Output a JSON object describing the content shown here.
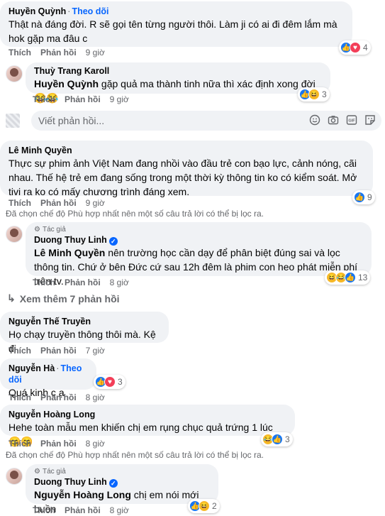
{
  "follow_label": "Theo dõi",
  "like_label": "Thích",
  "reply_label": "Phản hồi",
  "author_badge": "Tác giả",
  "filter_note": "Đã chọn chế độ Phù hợp nhất nên một số câu trả lời có thể bị lọc ra.",
  "reply_placeholder": "Viết phản hồi...",
  "see_more": "Xem thêm 7 phản hồi",
  "comments": [
    {
      "author": "Huyền Quỳnh",
      "text": "Thật nà đáng đời. R sẽ gọi tên từng người thôi. Làm ji có ai đi đêm lắm mà hok gặp ma đâu c",
      "time": "9 giờ",
      "reactions": "4"
    },
    {
      "author": "Thuỳ Trang Karoll",
      "mention": "Huyền Quỳnh",
      "text": " gặp quả ma thành tinh nữa thì xác định xong đời",
      "emoji": "😂😂",
      "time": "9 giờ",
      "reactions": "3"
    },
    {
      "author": "Lê Minh Quyền",
      "text": "Thực sự phim ảnh Việt Nam đang nhồi vào đầu trẻ con bạo lực, cảnh nóng, cãi nhau. Thế hệ trẻ em đang sống trong một thời kỳ thông tin ko có kiểm soát. Mở tivi ra ko có mấy chương trình đáng xem.",
      "time": "9 giờ",
      "reactions": "9"
    },
    {
      "author": "Duong Thuy Linh",
      "mention": "Lê Minh Quyền",
      "text": " nên trường học cần dạy để phân biệt đúng sai và lọc thông tin. Chứ ở bên Đức cứ sau 12h đêm là phim con heo phát miễn phí trên tv.",
      "time": "8 giờ",
      "reactions": "13"
    },
    {
      "author": "Nguyễn Thế Truyền",
      "text": "Họ chạy truyền thông thôi mà. Kệ đi",
      "time": "7 giờ"
    },
    {
      "author": "Nguyễn Hà",
      "text": "Quá kinh c ạ",
      "time": "8 giờ",
      "reactions": "3"
    },
    {
      "author": "Nguyễn Hoàng Long",
      "text": "Hehe toàn mẫu men khiến chị em rụng chục quả trứng 1 lúc",
      "emoji": "😊😊",
      "time": "8 giờ",
      "reactions": "3"
    },
    {
      "author": "Duong Thuy Linh",
      "mention": "Nguyễn Hoàng Long",
      "text": " chị em nói mới buồn",
      "time": "8 giờ",
      "reactions": "2"
    }
  ]
}
